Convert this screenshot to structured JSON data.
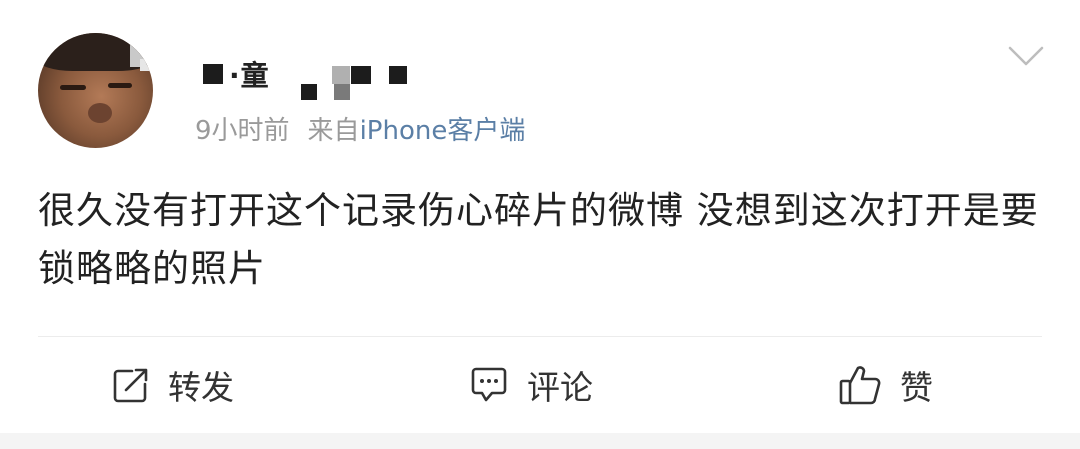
{
  "post": {
    "username": "·童",
    "time": "9小时前",
    "source_prefix": "来自",
    "source": "iPhone客户端",
    "content": "很久没有打开这个记录伤心碎片的微博 没想到这次打开是要锁略略的照片"
  },
  "actions": {
    "repost_label": "转发",
    "comment_label": "评论",
    "like_label": "赞"
  },
  "colors": {
    "source_link": "#5b7fa6",
    "meta_gray": "#9a9a9a",
    "text": "#222222"
  },
  "icons": [
    "chevron-down-icon",
    "repost-icon",
    "comment-icon",
    "like-icon"
  ]
}
